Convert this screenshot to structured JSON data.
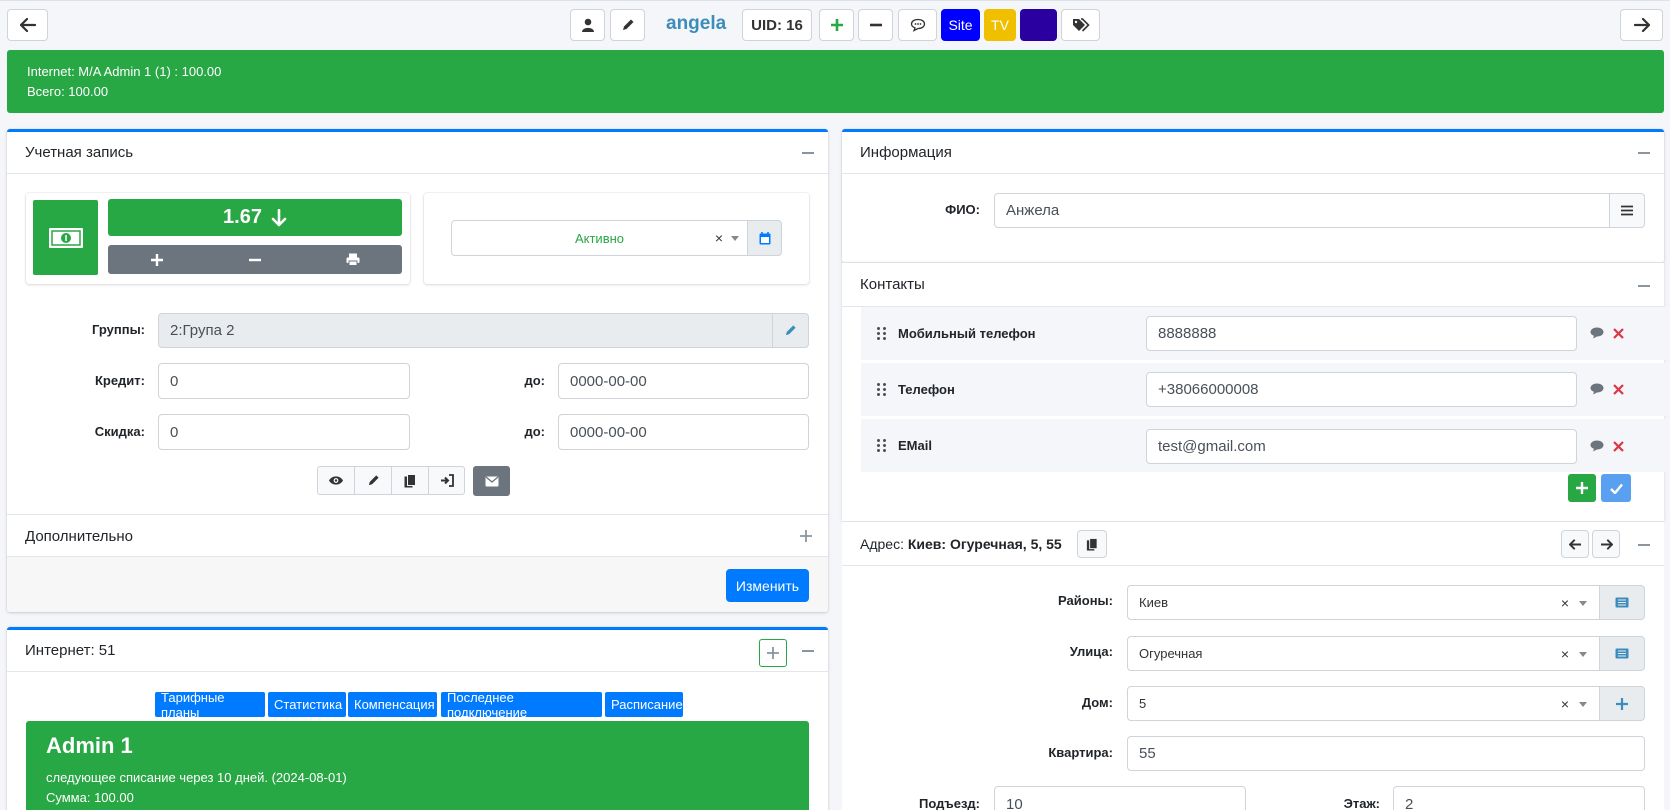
{
  "header": {
    "username": "angela",
    "uid": "UID: 16",
    "site_label": "Site",
    "tv_label": "TV",
    "colors": {
      "site": "#0000ff",
      "tv": "#f0c000",
      "purple": "#2b00a0",
      "user_link": "#3c8dbc"
    }
  },
  "banner": {
    "line1": "Internet: M/A Admin 1 (1) : 100.00",
    "line2": "Всего: 100.00",
    "color": "#28a745"
  },
  "account": {
    "title": "Учетная запись",
    "balance": "1.67",
    "status": "Активно",
    "groups_label": "Группы:",
    "groups_value": "2:Група 2",
    "credit_label": "Кредит:",
    "credit_value": "0",
    "credit_until_label": "до:",
    "credit_until_value": "0000-00-00",
    "discount_label": "Скидка:",
    "discount_value": "0",
    "discount_until_label": "до:",
    "discount_until_value": "0000-00-00",
    "extra_title": "Дополнительно",
    "change_button": "Изменить"
  },
  "internet": {
    "title": "Интернет: 51",
    "tabs": [
      "Тарифные планы",
      "Статистика",
      "Компенсация",
      "Последнее подключение",
      "Расписание"
    ],
    "plan_name": "Admin 1",
    "next_charge": "следующее списание через 10 дней. (2024-08-01)",
    "sum": "Сумма: 100.00"
  },
  "info": {
    "title": "Информация",
    "fio_label": "ФИО:",
    "fio_value": "Анжела"
  },
  "contacts": {
    "title": "Контакты",
    "items": [
      {
        "label": "Мобильный телефон",
        "value": "8888888"
      },
      {
        "label": "Телефон",
        "value": "+38066000008"
      },
      {
        "label": "EMail",
        "value": "test@gmail.com"
      }
    ]
  },
  "address": {
    "label": "Адрес:",
    "value": "Киев: Огуречная, 5, 55",
    "district_label": "Районы:",
    "district_value": "Киев",
    "street_label": "Улица:",
    "street_value": "Огуречная",
    "house_label": "Дом:",
    "house_value": "5",
    "flat_label": "Квартира:",
    "flat_value": "55",
    "entrance_label": "Подъезд:",
    "entrance_value": "10",
    "floor_label": "Этаж:",
    "floor_value": "2"
  }
}
